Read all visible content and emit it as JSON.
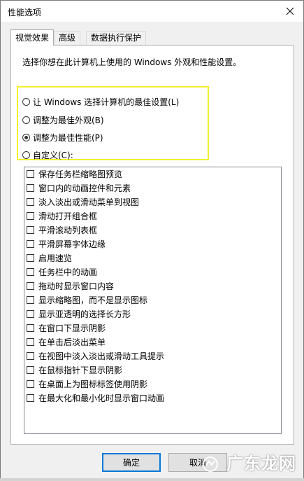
{
  "window": {
    "title": "性能选项"
  },
  "tabs": [
    {
      "label": "视觉效果",
      "active": true
    },
    {
      "label": "高级",
      "active": false
    },
    {
      "label": "数据执行保护",
      "active": false
    }
  ],
  "description": "选择你想在此计算机上使用的 Windows 外观和性能设置。",
  "radios": [
    {
      "label": "让 Windows 选择计算机的最佳设置(L)",
      "checked": false
    },
    {
      "label": "调整为最佳外观(B)",
      "checked": false
    },
    {
      "label": "调整为最佳性能(P)",
      "checked": true
    },
    {
      "label": "自定义(C):",
      "checked": false
    }
  ],
  "effects": [
    {
      "label": "保存任务栏缩略图预览",
      "checked": false
    },
    {
      "label": "窗口内的动画控件和元素",
      "checked": false
    },
    {
      "label": "淡入淡出或滑动菜单到视图",
      "checked": false
    },
    {
      "label": "滑动打开组合框",
      "checked": false
    },
    {
      "label": "平滑滚动列表框",
      "checked": false
    },
    {
      "label": "平滑屏幕字体边缘",
      "checked": false
    },
    {
      "label": "启用速览",
      "checked": false
    },
    {
      "label": "任务栏中的动画",
      "checked": false
    },
    {
      "label": "拖动时显示窗口内容",
      "checked": false
    },
    {
      "label": "显示缩略图，而不是显示图标",
      "checked": false
    },
    {
      "label": "显示亚透明的选择长方形",
      "checked": false
    },
    {
      "label": "在窗口下显示阴影",
      "checked": false
    },
    {
      "label": "在单击后淡出菜单",
      "checked": false
    },
    {
      "label": "在视图中淡入淡出或滑动工具提示",
      "checked": false
    },
    {
      "label": "在鼠标指针下显示阴影",
      "checked": false
    },
    {
      "label": "在桌面上为图标标签使用阴影",
      "checked": false
    },
    {
      "label": "在最大化和最小化时显示窗口动画",
      "checked": false
    }
  ],
  "buttons": {
    "ok": "确定",
    "cancel": "取消"
  },
  "watermark": {
    "text": "广东龙网"
  },
  "colors": {
    "highlight_border": "#f5ef2e",
    "default_button_border": "#0078d7"
  }
}
